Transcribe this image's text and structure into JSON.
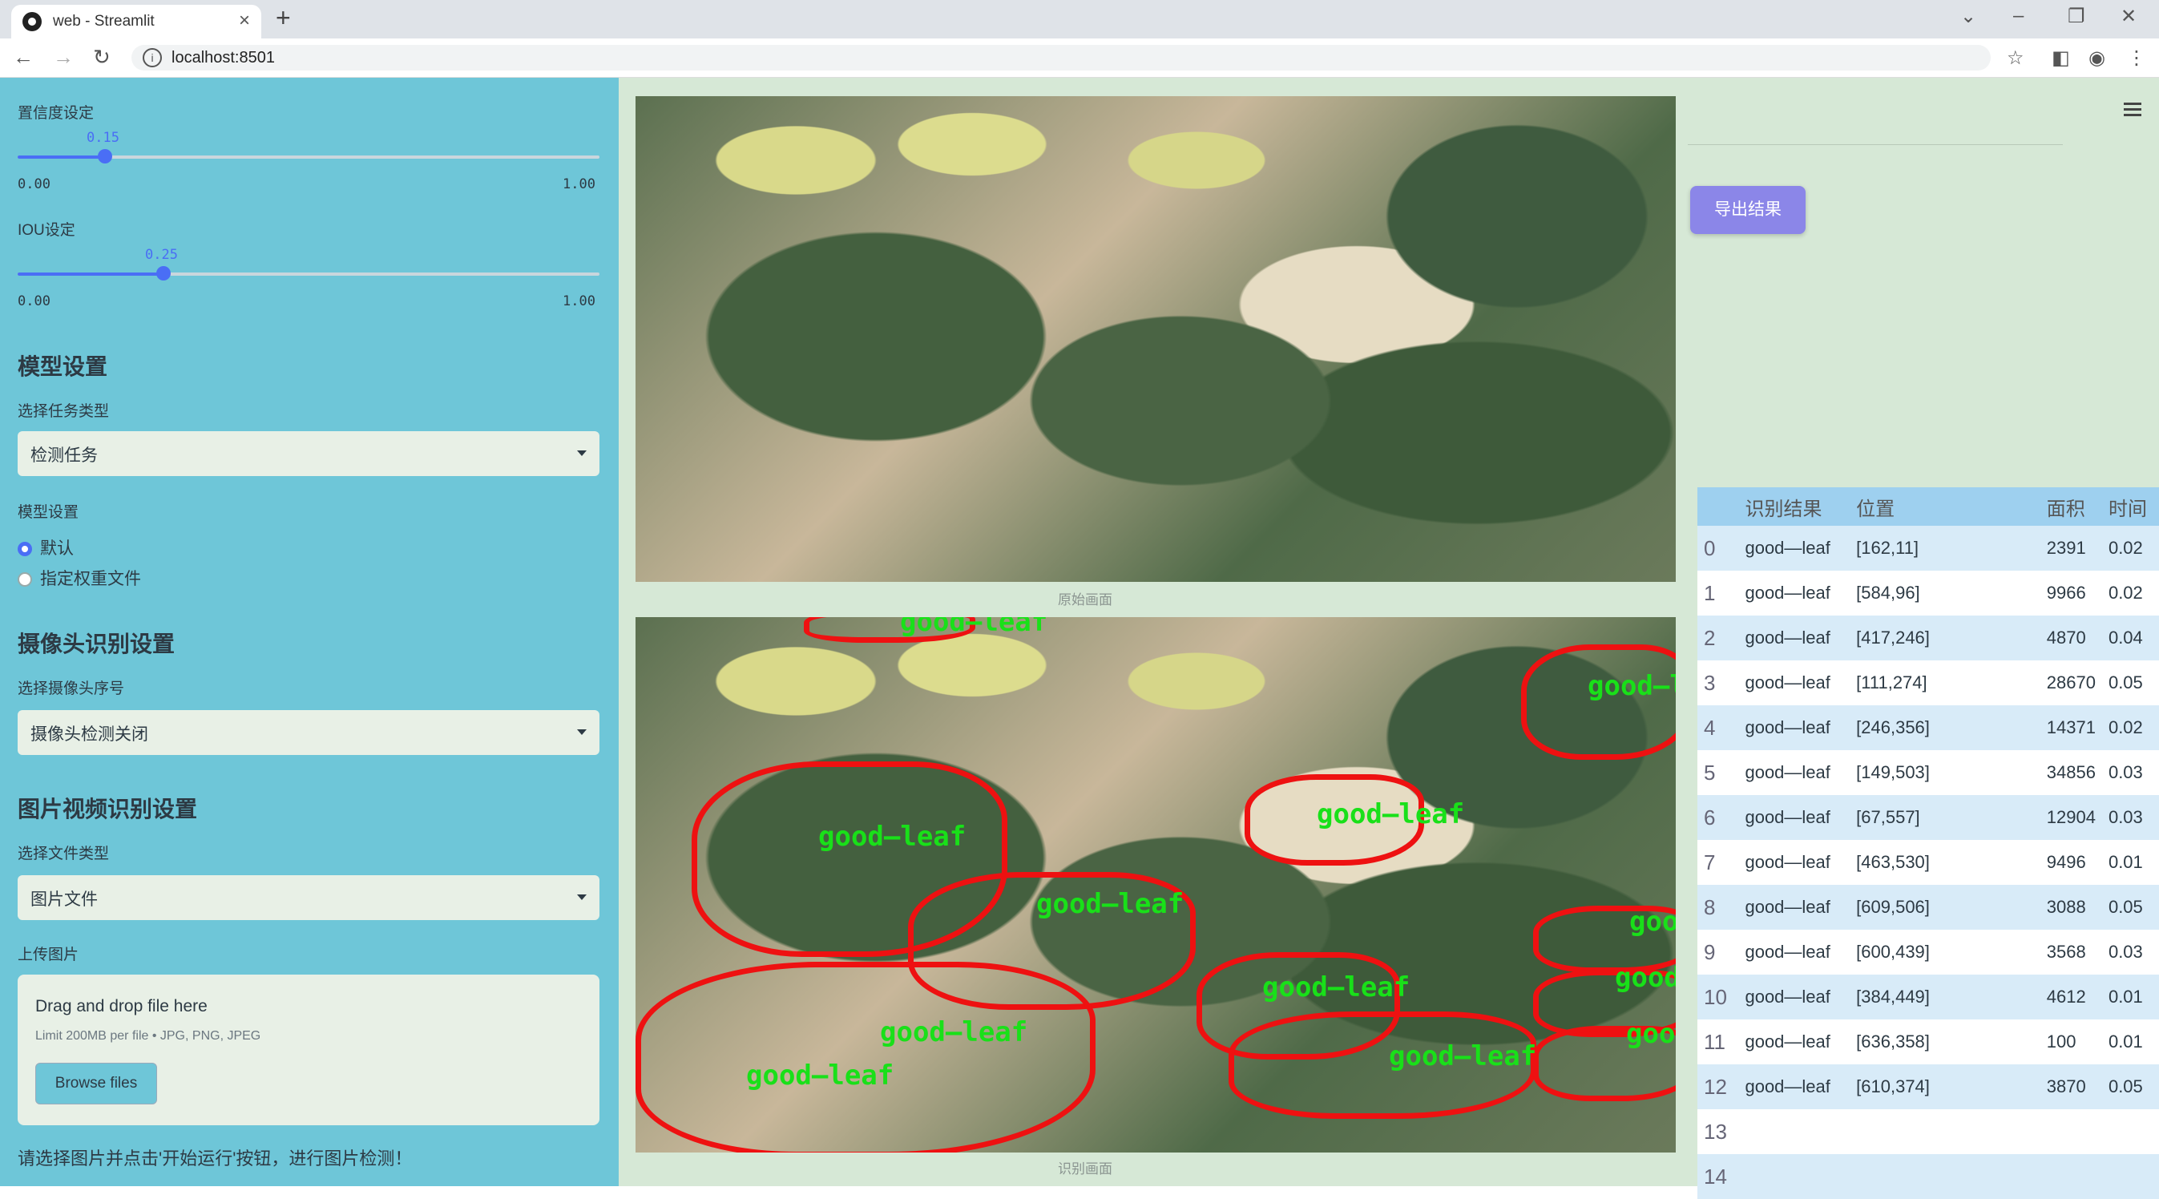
{
  "browser": {
    "tab_title": "web - Streamlit",
    "url": "localhost:8501"
  },
  "sidebar": {
    "confidence": {
      "label": "置信度设定",
      "value": "0.15",
      "fraction": 0.15,
      "min": "0.00",
      "max": "1.00"
    },
    "iou": {
      "label": "IOU设定",
      "value": "0.25",
      "fraction": 0.25,
      "min": "0.00",
      "max": "1.00"
    },
    "model_heading": "模型设置",
    "task_label": "选择任务类型",
    "task_value": "检测任务",
    "model_label": "模型设置",
    "radio_default": "默认",
    "radio_custom": "指定权重文件",
    "camera_heading": "摄像头识别设置",
    "camera_label": "选择摄像头序号",
    "camera_value": "摄像头检测关闭",
    "file_heading": "图片视频识别设置",
    "file_type_label": "选择文件类型",
    "file_type_value": "图片文件",
    "upload_label": "上传图片",
    "upload_drop": "Drag and drop file here",
    "upload_limit": "Limit 200MB per file • JPG, PNG, JPEG",
    "browse_button": "Browse files",
    "hint": "请选择图片并点击'开始运行'按钮，进行图片检测！"
  },
  "main": {
    "original_caption": "原始画面",
    "detected_caption": "识别画面",
    "detection_label": "good—leaf",
    "export_button": "导出结果",
    "table": {
      "headers": [
        "",
        "识别结果",
        "位置",
        "面积",
        "时间"
      ],
      "rows": [
        {
          "idx": "0",
          "result": "good—leaf",
          "pos": "[162,11]",
          "area": "2391",
          "time": "0.02"
        },
        {
          "idx": "1",
          "result": "good—leaf",
          "pos": "[584,96]",
          "area": "9966",
          "time": "0.02"
        },
        {
          "idx": "2",
          "result": "good—leaf",
          "pos": "[417,246]",
          "area": "4870",
          "time": "0.04"
        },
        {
          "idx": "3",
          "result": "good—leaf",
          "pos": "[111,274]",
          "area": "28670",
          "time": "0.05"
        },
        {
          "idx": "4",
          "result": "good—leaf",
          "pos": "[246,356]",
          "area": "14371",
          "time": "0.02"
        },
        {
          "idx": "5",
          "result": "good—leaf",
          "pos": "[149,503]",
          "area": "34856",
          "time": "0.03"
        },
        {
          "idx": "6",
          "result": "good—leaf",
          "pos": "[67,557]",
          "area": "12904",
          "time": "0.03"
        },
        {
          "idx": "7",
          "result": "good—leaf",
          "pos": "[463,530]",
          "area": "9496",
          "time": "0.01"
        },
        {
          "idx": "8",
          "result": "good—leaf",
          "pos": "[609,506]",
          "area": "3088",
          "time": "0.05"
        },
        {
          "idx": "9",
          "result": "good—leaf",
          "pos": "[600,439]",
          "area": "3568",
          "time": "0.03"
        },
        {
          "idx": "10",
          "result": "good—leaf",
          "pos": "[384,449]",
          "area": "4612",
          "time": "0.01"
        },
        {
          "idx": "11",
          "result": "good—leaf",
          "pos": "[636,358]",
          "area": "100",
          "time": "0.01"
        },
        {
          "idx": "12",
          "result": "good—leaf",
          "pos": "[610,374]",
          "area": "3870",
          "time": "0.05"
        },
        {
          "idx": "13",
          "result": "",
          "pos": "",
          "area": "",
          "time": ""
        },
        {
          "idx": "14",
          "result": "",
          "pos": "",
          "area": "",
          "time": ""
        }
      ]
    }
  }
}
